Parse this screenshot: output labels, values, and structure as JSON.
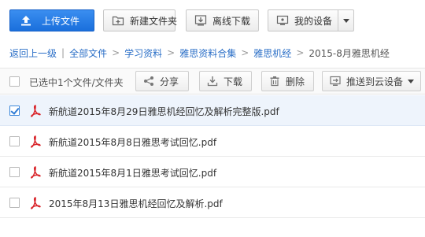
{
  "toolbar": {
    "upload_label": "上传文件",
    "new_folder_label": "新建文件夹",
    "offline_download_label": "离线下载",
    "my_device_label": "我的设备"
  },
  "breadcrumb": {
    "back": "返回上一级",
    "items": [
      "全部文件",
      "学习资料",
      "雅思资料合集",
      "雅思机经"
    ],
    "current": "2015-8月雅思机经"
  },
  "actions": {
    "selection_text": "已选中1个文件/文件夹",
    "share": "分享",
    "download": "下载",
    "delete": "删除",
    "push_to_device": "推送到云设备"
  },
  "files": [
    {
      "name": "新航道2015年8月29日雅思机经回忆及解析完整版.pdf",
      "checked": true
    },
    {
      "name": "新航道2015年8月8日雅思考试回忆.pdf",
      "checked": false
    },
    {
      "name": "新航道2015年8月1日雅思考试回忆.pdf",
      "checked": false
    },
    {
      "name": "2015年8月13日雅思机经回忆及解析.pdf",
      "checked": false
    }
  ],
  "colors": {
    "accent": "#1a6fdc",
    "link": "#2b6fc7",
    "pdf_red": "#d9262c",
    "selected_row": "#eef4fc"
  }
}
